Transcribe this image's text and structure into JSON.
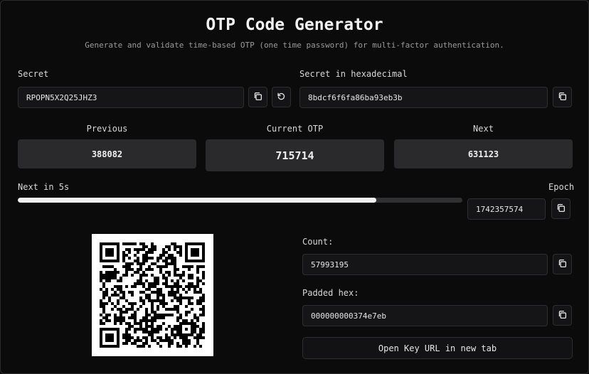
{
  "header": {
    "title": "OTP Code Generator",
    "subtitle": "Generate and validate time-based OTP (one time password) for multi-factor authentication."
  },
  "secret": {
    "label": "Secret",
    "value": "RPOPN5X2Q25JHZ3",
    "copy_icon": "copy-icon",
    "refresh_icon": "refresh-icon"
  },
  "secret_hex": {
    "label": "Secret in hexadecimal",
    "value": "8bdcf6f6fa86ba93eb3b",
    "copy_icon": "copy-icon"
  },
  "otp": {
    "previous_label": "Previous",
    "previous_value": "388082",
    "current_label": "Current OTP",
    "current_value": "715714",
    "next_label": "Next",
    "next_value": "631123"
  },
  "timer": {
    "label": "Next in 5s",
    "progress_fraction": 0.807
  },
  "epoch": {
    "label": "Epoch",
    "value": "1742357574",
    "copy_icon": "copy-icon"
  },
  "qr": {
    "icon": "qr-code"
  },
  "count": {
    "label": "Count:",
    "value": "57993195",
    "copy_icon": "copy-icon"
  },
  "padded_hex": {
    "label": "Padded hex:",
    "value": "000000000374e7eb",
    "copy_icon": "copy-icon"
  },
  "open_url_button": "Open Key URL in new tab",
  "colors": {
    "background": "#0b0b0c",
    "field": "#151517",
    "otp_box": "#2a2a2c",
    "progress_fill": "#f2f2f2",
    "progress_track": "#303033"
  }
}
